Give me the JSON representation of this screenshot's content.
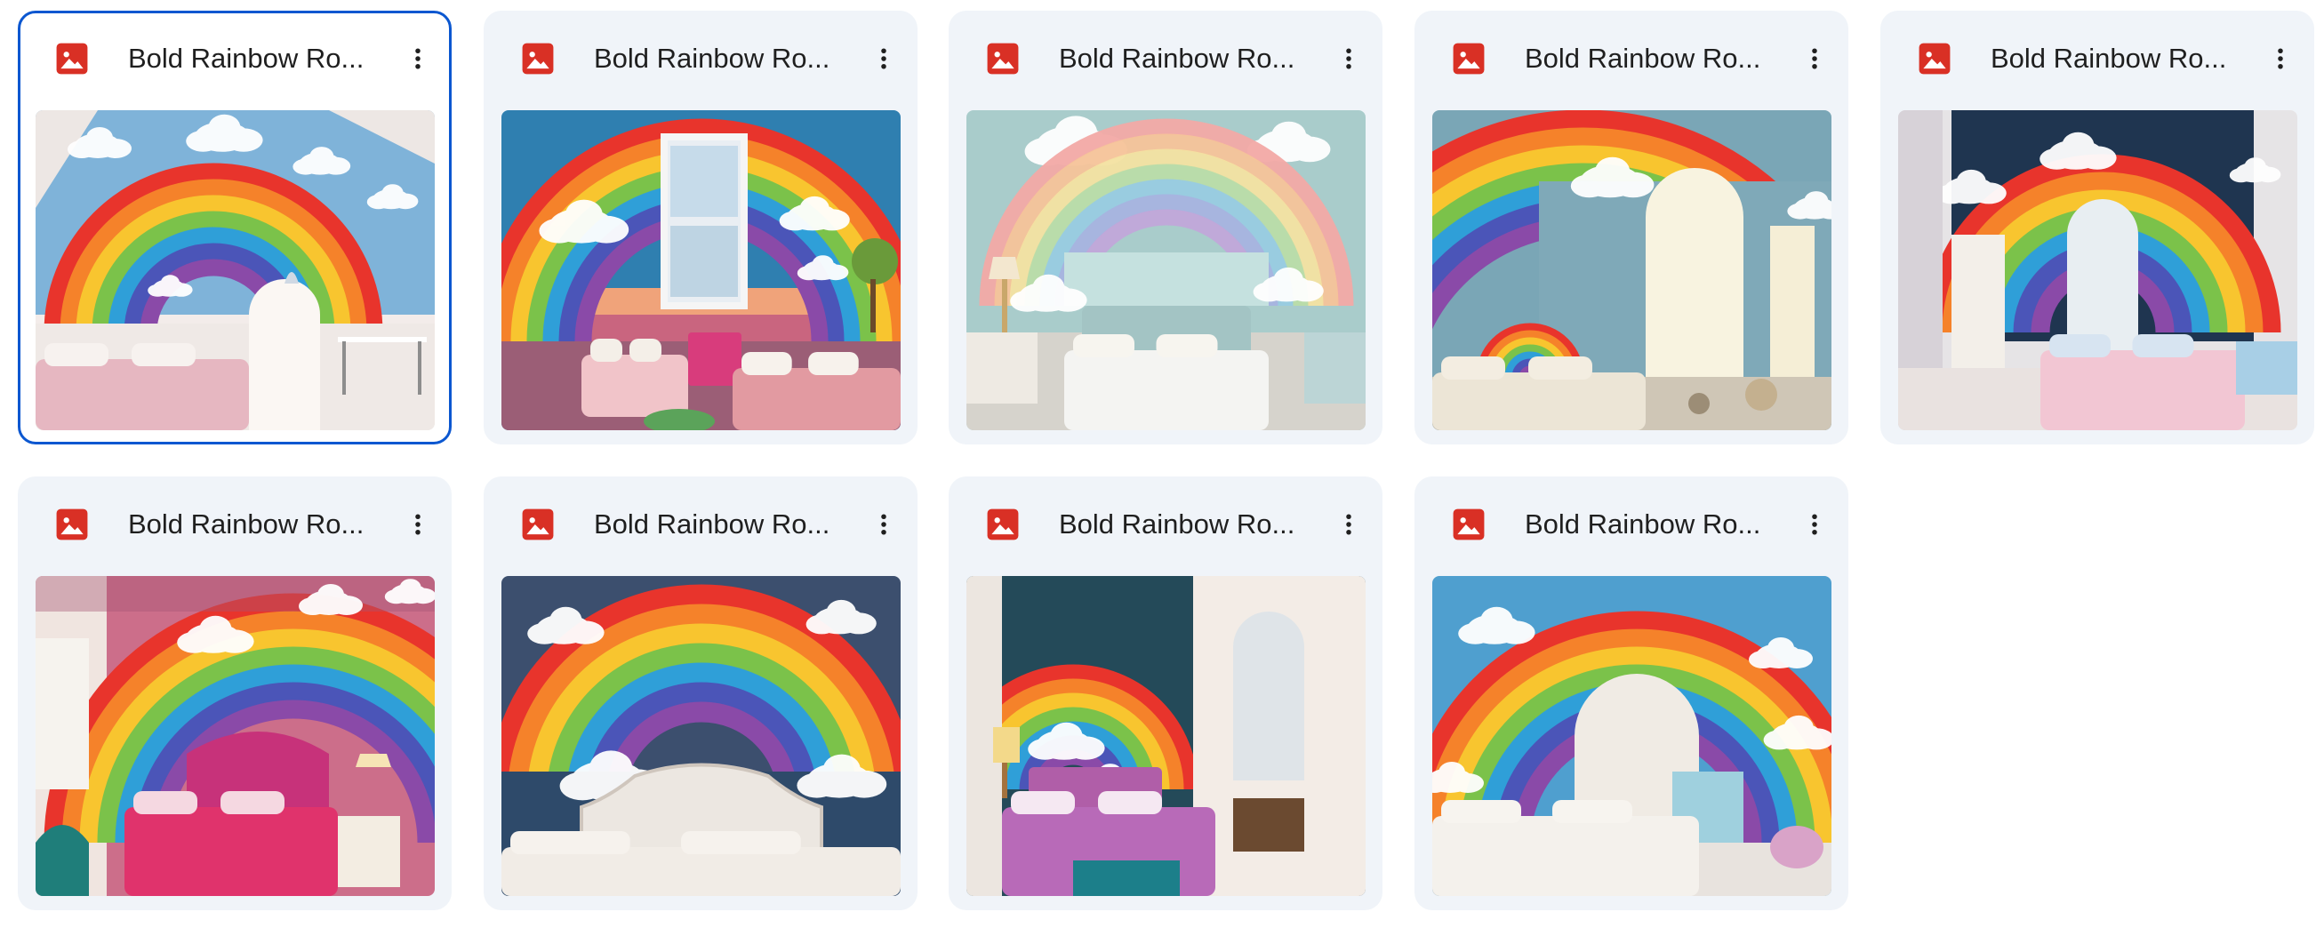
{
  "files": [
    {
      "name": "Bold Rainbow Ro...",
      "icon": "image-file-icon",
      "selected": true,
      "scene": "attic-arch"
    },
    {
      "name": "Bold Rainbow Ro...",
      "icon": "image-file-icon",
      "selected": false,
      "scene": "window-sunset"
    },
    {
      "name": "Bold Rainbow Ro...",
      "icon": "image-file-icon",
      "selected": false,
      "scene": "pastel-bed"
    },
    {
      "name": "Bold Rainbow Ro...",
      "icon": "image-file-icon",
      "selected": false,
      "scene": "arched-window"
    },
    {
      "name": "Bold Rainbow Ro...",
      "icon": "image-file-icon",
      "selected": false,
      "scene": "dark-wall-window"
    },
    {
      "name": "Bold Rainbow Ro...",
      "icon": "image-file-icon",
      "selected": false,
      "scene": "pink-headboard"
    },
    {
      "name": "Bold Rainbow Ro...",
      "icon": "image-file-icon",
      "selected": false,
      "scene": "cloud-mural"
    },
    {
      "name": "Bold Rainbow Ro...",
      "icon": "image-file-icon",
      "selected": false,
      "scene": "brick-window"
    },
    {
      "name": "Bold Rainbow Ro...",
      "icon": "image-file-icon",
      "selected": false,
      "scene": "white-bed-arch"
    }
  ],
  "colors": {
    "file_icon_red": "#d93025",
    "selected_border": "#0b57d0",
    "card_bg": "#f0f4f9",
    "rainbow": [
      "#e8342c",
      "#f5822a",
      "#f8c52f",
      "#7bc24a",
      "#2f9fd8",
      "#4b55b8",
      "#8a4aa8"
    ]
  }
}
